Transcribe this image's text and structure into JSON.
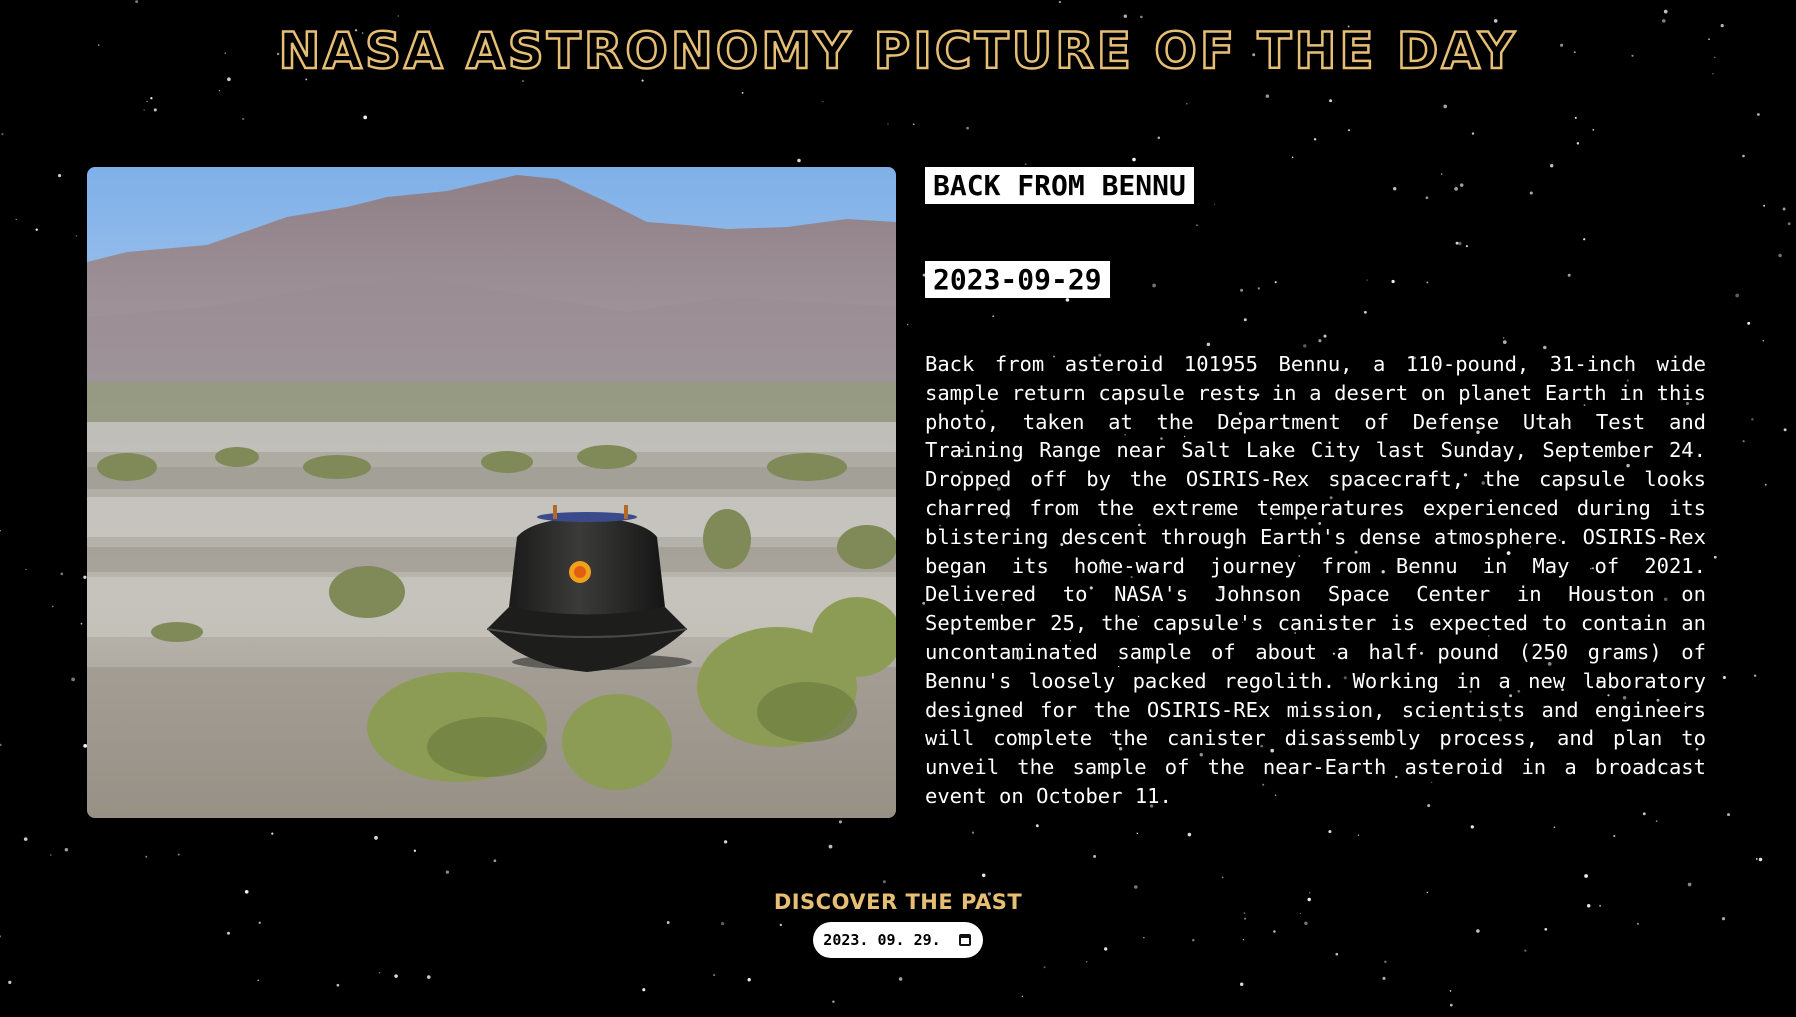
{
  "header": {
    "title": "NASA ASTRONOMY PICTURE OF THE DAY"
  },
  "apod": {
    "title": "BACK FROM BENNU",
    "date": "2023-09-29",
    "explanation": "Back from asteroid 101955 Bennu, a 110-pound, 31-inch wide sample return capsule rests in a desert on planet Earth in this photo, taken at the Department of Defense Utah Test and Training Range near Salt Lake City last Sunday, September 24. Dropped off by the OSIRIS-Rex spacecraft, the capsule looks charred from the extreme temperatures experienced during its blistering descent through Earth's dense atmosphere. OSIRIS-Rex began its home-ward journey from Bennu in May of 2021. Delivered to NASA's Johnson Space Center in Houston on September 25, the capsule's canister is expected to contain an uncontaminated sample of about a half pound (250 grams) of Bennu's loosely packed regolith. Working in a new laboratory designed for the OSIRIS-REx mission, scientists and engineers will complete the canister disassembly process, and plan to unveil the sample of the near-Earth asteroid in a broadcast event on October 11."
  },
  "discover": {
    "title": "DISCOVER THE PAST",
    "date_value": "2023. 09. 29.",
    "calendar_icon": "calendar-icon"
  },
  "colors": {
    "background": "#000000",
    "accent": "#e7bf74",
    "text": "#ffffff"
  }
}
